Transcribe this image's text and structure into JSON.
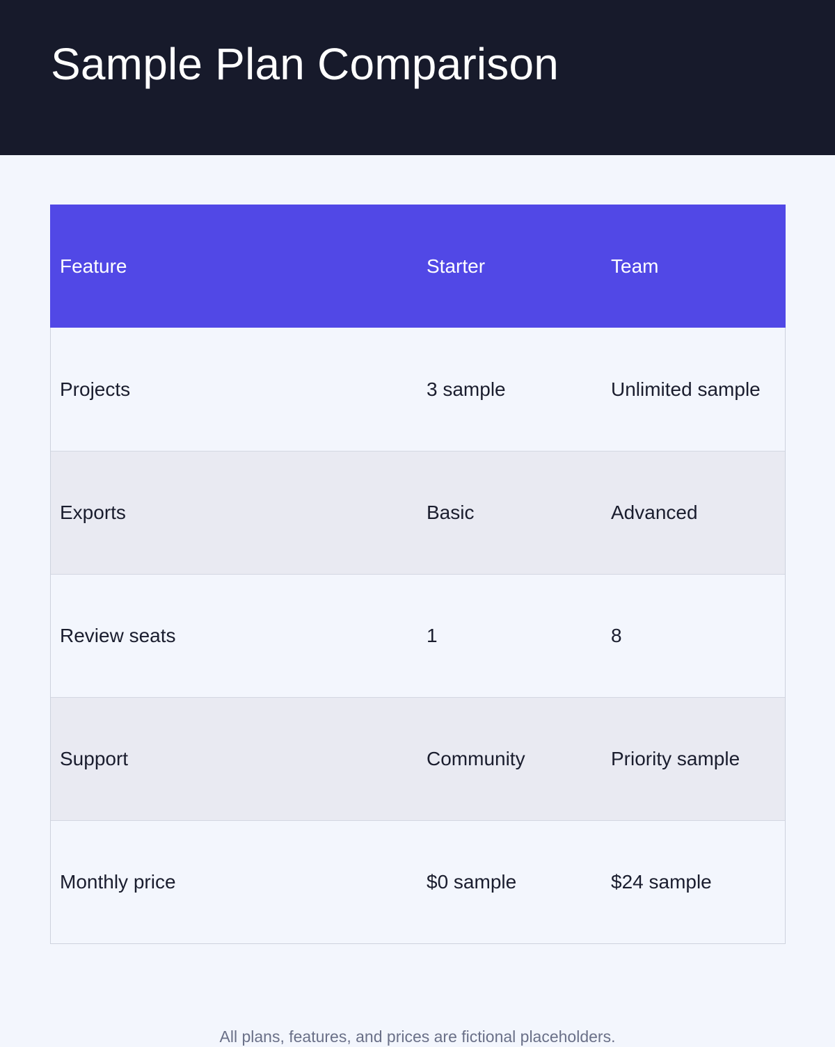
{
  "header": {
    "title": "Sample Plan Comparison"
  },
  "table": {
    "columns": [
      "Feature",
      "Starter",
      "Team"
    ],
    "rows": [
      {
        "feature": "Projects",
        "starter": "3 sample",
        "team": "Unlimited sample"
      },
      {
        "feature": "Exports",
        "starter": "Basic",
        "team": "Advanced"
      },
      {
        "feature": "Review seats",
        "starter": "1",
        "team": "8"
      },
      {
        "feature": "Support",
        "starter": "Community",
        "team": "Priority sample"
      },
      {
        "feature": "Monthly price",
        "starter": "$0 sample",
        "team": "$24 sample"
      }
    ]
  },
  "footnote": "All plans, features, and prices are fictional placeholders.",
  "colors": {
    "header_background": "#171a2b",
    "table_header_background": "#5148e6",
    "page_background": "#f3f6fd",
    "striped_row_background": "#e9eaf2",
    "body_text": "#1a1d2e",
    "footnote_text": "#6a7088"
  }
}
